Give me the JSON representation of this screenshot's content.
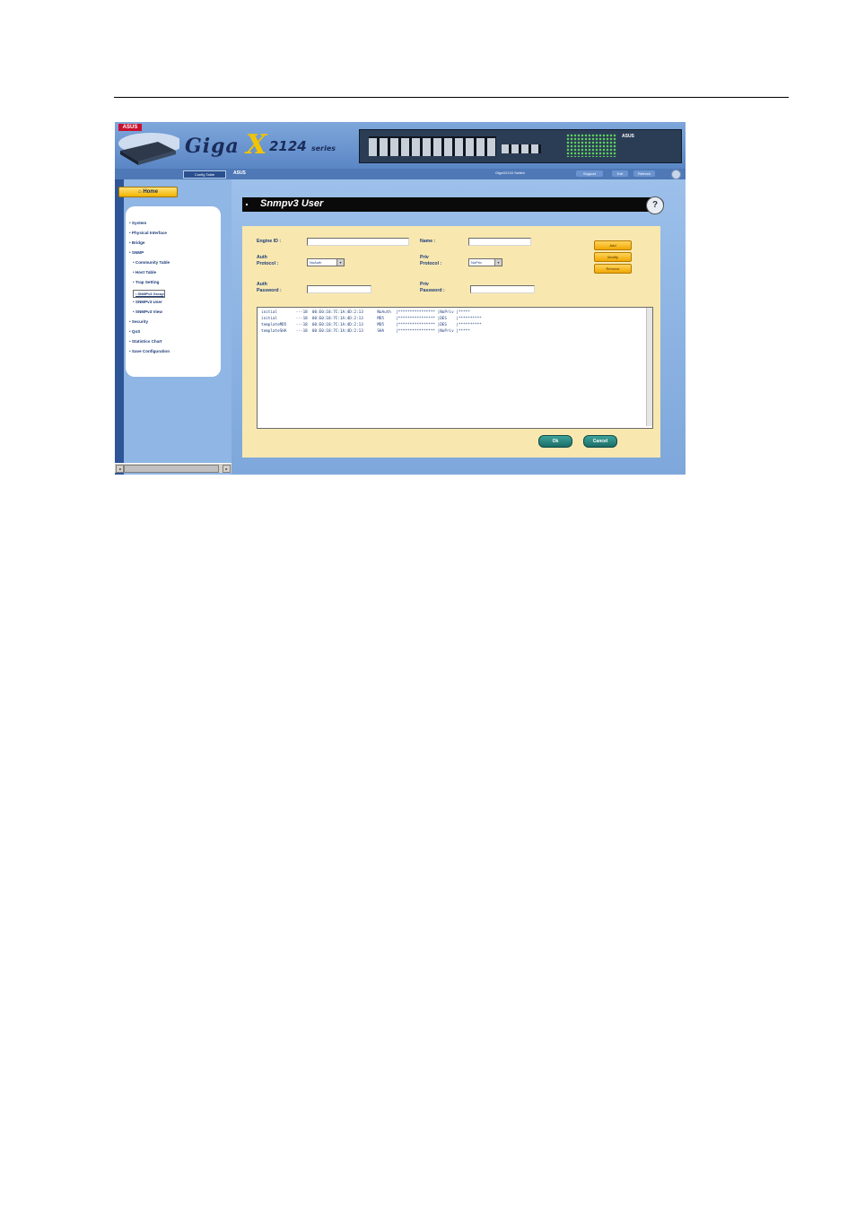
{
  "header": {
    "logo": "ASUS",
    "brand": "Giga",
    "brand_x": "X",
    "series": "2124",
    "series_suffix": "series",
    "panel_brand": "ASUS"
  },
  "nav": {
    "tab": "Config Table",
    "section": "ASUS",
    "status": "GigaX2124 Switch",
    "buttons": [
      "Support",
      "Exit",
      "Refresh"
    ]
  },
  "sidebar": {
    "home": "Home",
    "items": [
      {
        "label": "System",
        "indent": 0
      },
      {
        "label": "Physical Interface",
        "indent": 0
      },
      {
        "label": "Bridge",
        "indent": 0
      },
      {
        "label": "SNMP",
        "indent": 0
      },
      {
        "label": "Community Table",
        "indent": 1
      },
      {
        "label": "Host Table",
        "indent": 1
      },
      {
        "label": "Trap Setting",
        "indent": 1
      },
      {
        "label": "SNMPv3 Group",
        "indent": 1
      },
      {
        "label": "SNMPv3 User",
        "indent": 1
      },
      {
        "label": "SNMPv3 View",
        "indent": 1
      },
      {
        "label": "Security",
        "indent": 0
      },
      {
        "label": "QoS",
        "indent": 0
      },
      {
        "label": "Statistics Chart",
        "indent": 0
      },
      {
        "label": "Save Configuration",
        "indent": 0
      }
    ]
  },
  "page": {
    "title": "Snmpv3 User",
    "help_symbol": "?"
  },
  "form": {
    "engine_id_label": "Engine ID :",
    "engine_id_value": "",
    "name_label": "Name :",
    "name_value": "",
    "auth_protocol_label_1": "Auth",
    "auth_protocol_label_2": "Protocol :",
    "auth_protocol_value": "NoAuth",
    "priv_protocol_label_1": "Priv",
    "priv_protocol_label_2": "Protocol :",
    "priv_protocol_value": "NoPriv",
    "auth_password_label_1": "Auth",
    "auth_password_label_2": "Password :",
    "auth_password_value": "",
    "priv_password_label_1": "Priv",
    "priv_password_label_2": "Password :",
    "priv_password_value": "",
    "add_label": "Add",
    "modify_label": "Modify",
    "remove_label": "Remove"
  },
  "users": [
    "initial        ---18  00:E0:18:7C:1A:4D:2:13      NoAuth  |**************** |NoPriv |*****",
    "initial        ---18  00:E0:18:7C:1A:4D:2:13      MD5     |**************** |DES    |**********",
    "templateMD5    ---18  00:E0:18:7C:1A:4D:2:13      MD5     |**************** |DES    |**********",
    "templateSHA    ---18  00:E0:18:7C:1A:4D:2:13      SHA     |**************** |NoPriv |*****"
  ],
  "actions": {
    "ok": "Ok",
    "cancel": "Cancel"
  }
}
